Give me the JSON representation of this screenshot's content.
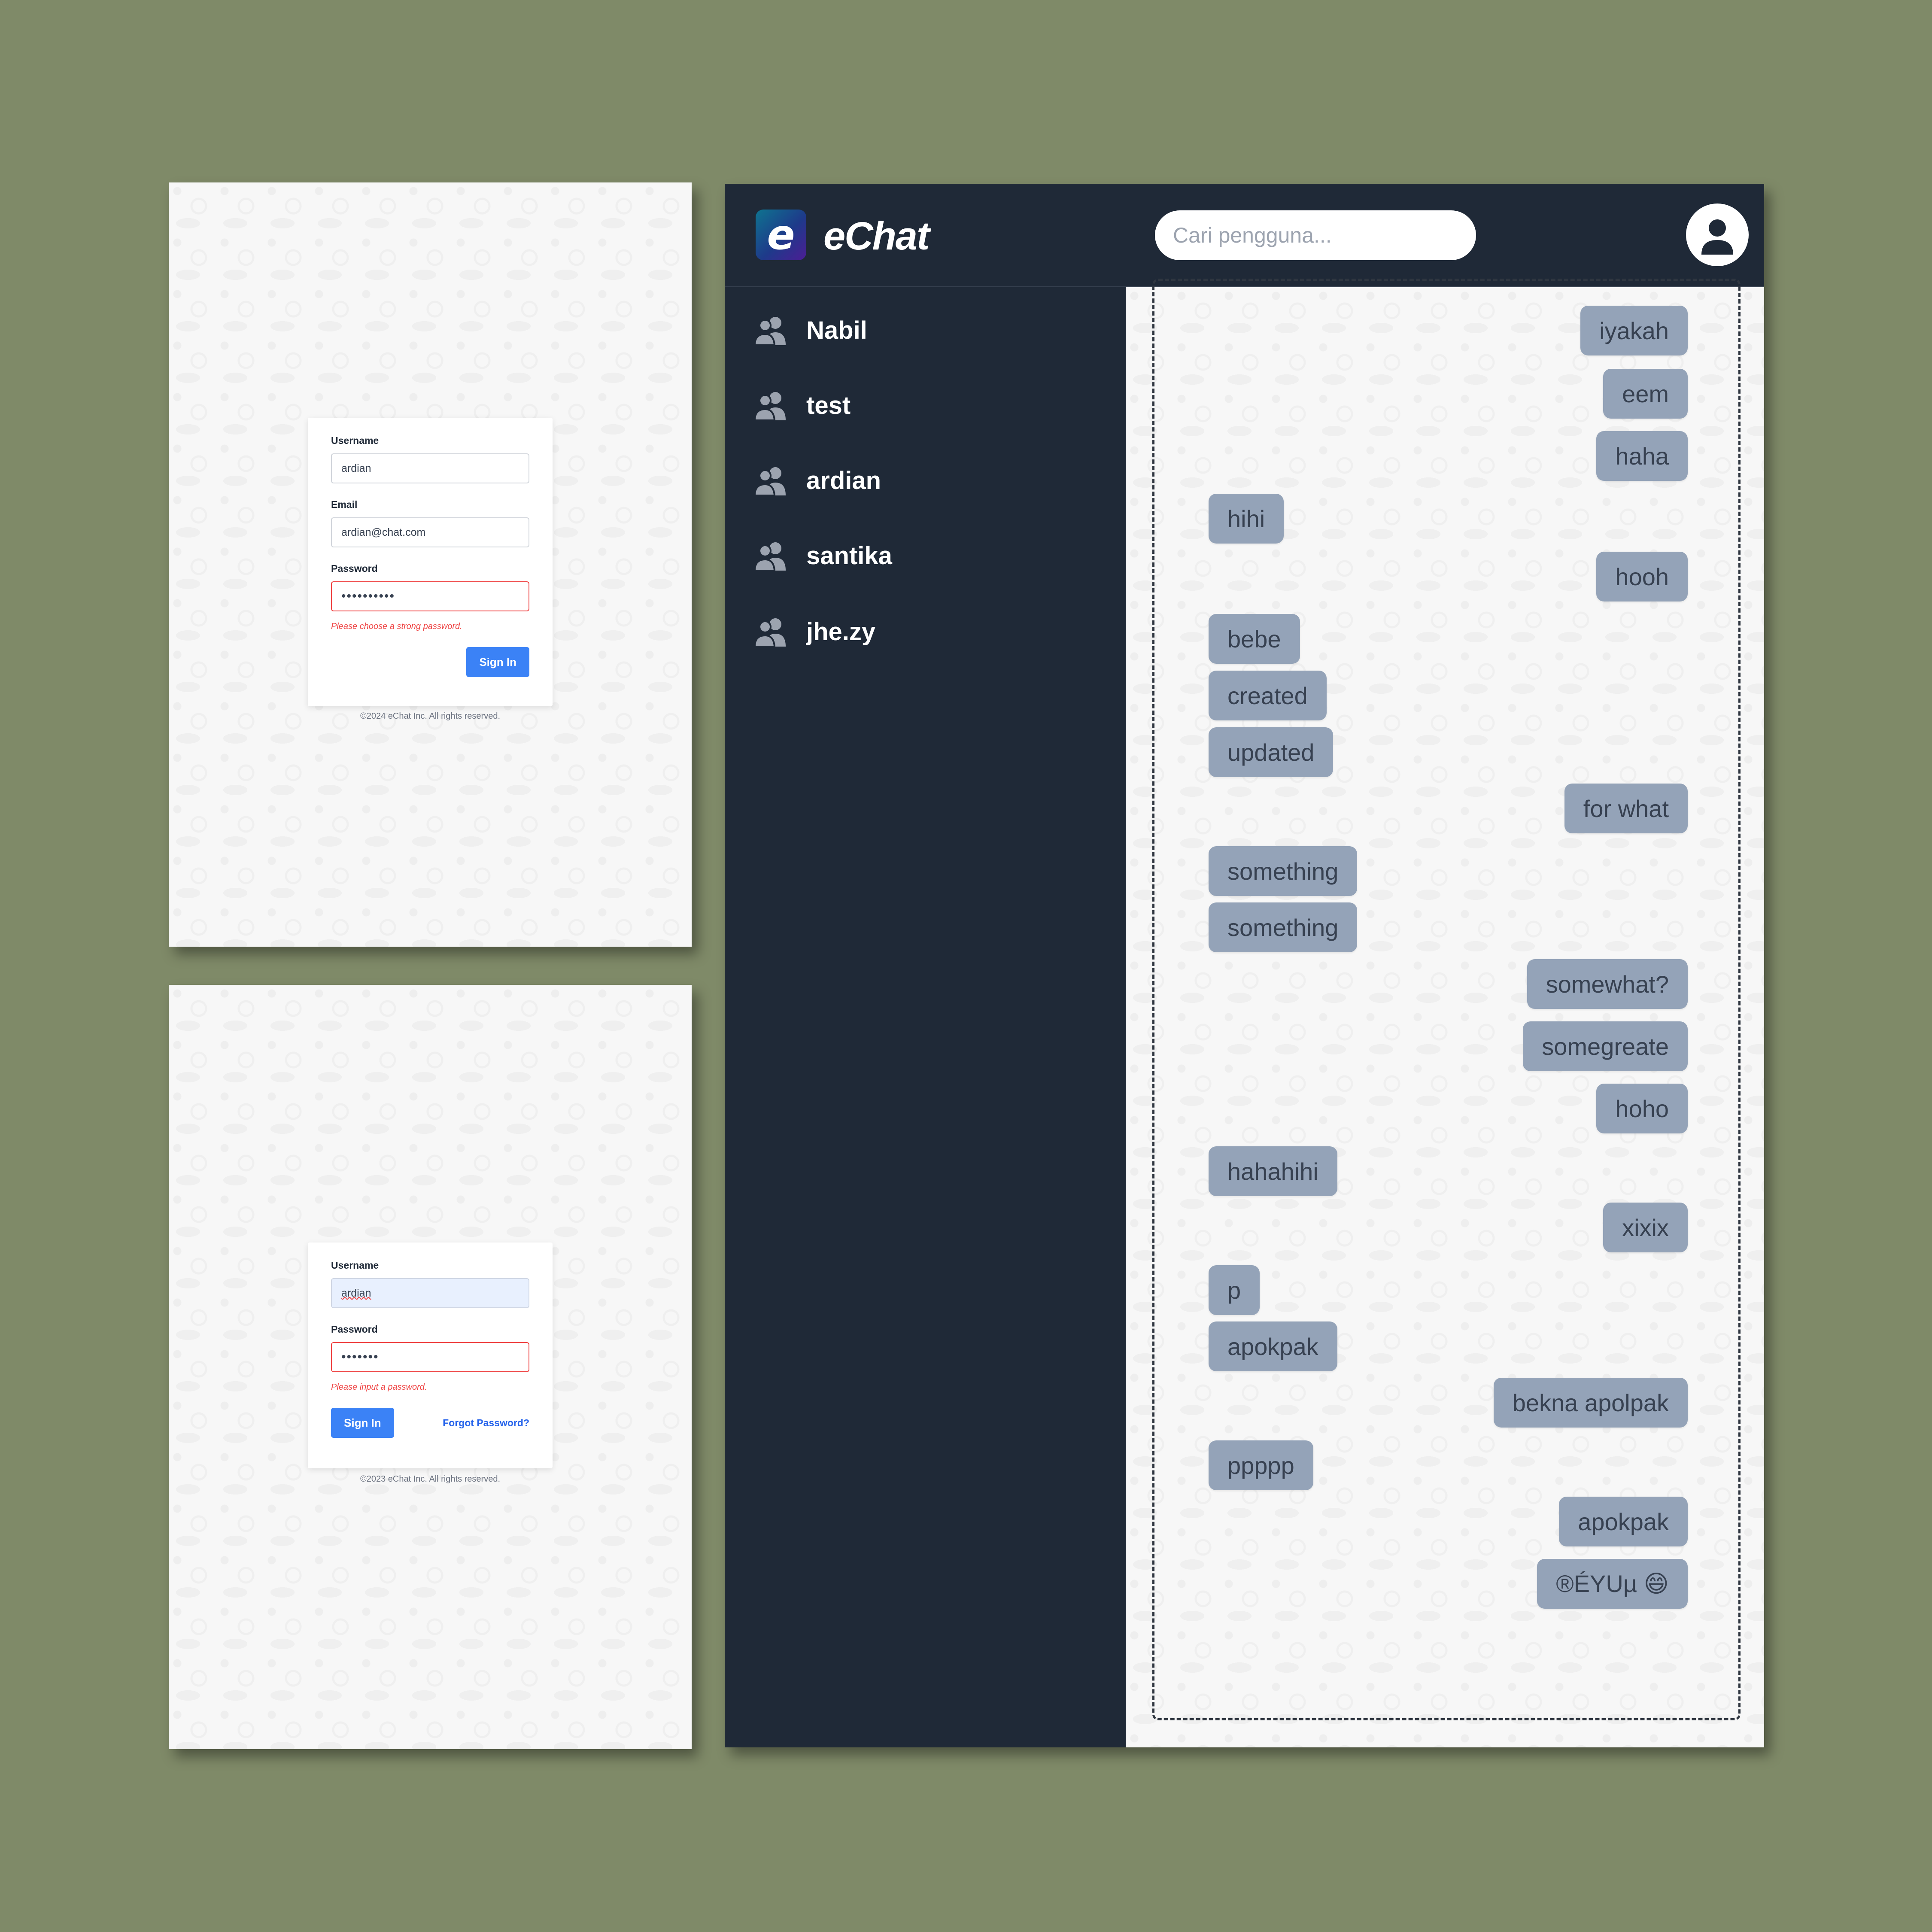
{
  "register_screen": {
    "username_label": "Username",
    "username_value": "ardian",
    "email_label": "Email",
    "email_value": "ardian@chat.com",
    "password_label": "Password",
    "password_value": "••••••••••",
    "password_error": "Please choose a strong password.",
    "submit_label": "Sign In",
    "copyright": "©2024 eChat Inc. All rights reserved."
  },
  "login_screen": {
    "username_label": "Username",
    "username_value": "ardian",
    "password_label": "Password",
    "password_value": "•••••••",
    "password_error": "Please input a password.",
    "submit_label": "Sign In",
    "forgot_label": "Forgot Password?",
    "copyright": "©2023 eChat Inc. All rights reserved."
  },
  "app": {
    "logo_letter": "e",
    "brand": "eChat",
    "search_placeholder": "Cari pengguna...",
    "contacts": [
      "Nabil",
      "test",
      "ardian",
      "santika",
      "jhe.zy"
    ],
    "messages": [
      {
        "text": "iyakah",
        "side": "right"
      },
      {
        "text": "eem",
        "side": "right"
      },
      {
        "text": "haha",
        "side": "right"
      },
      {
        "text": "hihi",
        "side": "left"
      },
      {
        "text": "hooh",
        "side": "right"
      },
      {
        "text": "bebe",
        "side": "left"
      },
      {
        "text": "created",
        "side": "left"
      },
      {
        "text": "updated",
        "side": "left"
      },
      {
        "text": "for what",
        "side": "right"
      },
      {
        "text": "something",
        "side": "left"
      },
      {
        "text": "something",
        "side": "left"
      },
      {
        "text": "somewhat?",
        "side": "right"
      },
      {
        "text": "somegreate",
        "side": "right"
      },
      {
        "text": "hoho",
        "side": "right"
      },
      {
        "text": "hahahihi",
        "side": "left"
      },
      {
        "text": "xixix",
        "side": "right"
      },
      {
        "text": "p",
        "side": "left"
      },
      {
        "text": "apokpak",
        "side": "left"
      },
      {
        "text": "bekna apolpak",
        "side": "right"
      },
      {
        "text": "ppppp",
        "side": "left"
      },
      {
        "text": "apokpak",
        "side": "right"
      },
      {
        "text": "®ÉYUµ 😄",
        "side": "right"
      }
    ],
    "message_input_value": "",
    "colors": {
      "dark_bg": "#1f2937",
      "bubble": "#94a3b8",
      "primary_button": "#3b82f6",
      "error": "#ef4444",
      "backdrop": "#7f8a68"
    },
    "icons": {
      "avatar": "user-circle-icon",
      "contact": "users-icon",
      "send": "send-arrow-icon"
    }
  }
}
